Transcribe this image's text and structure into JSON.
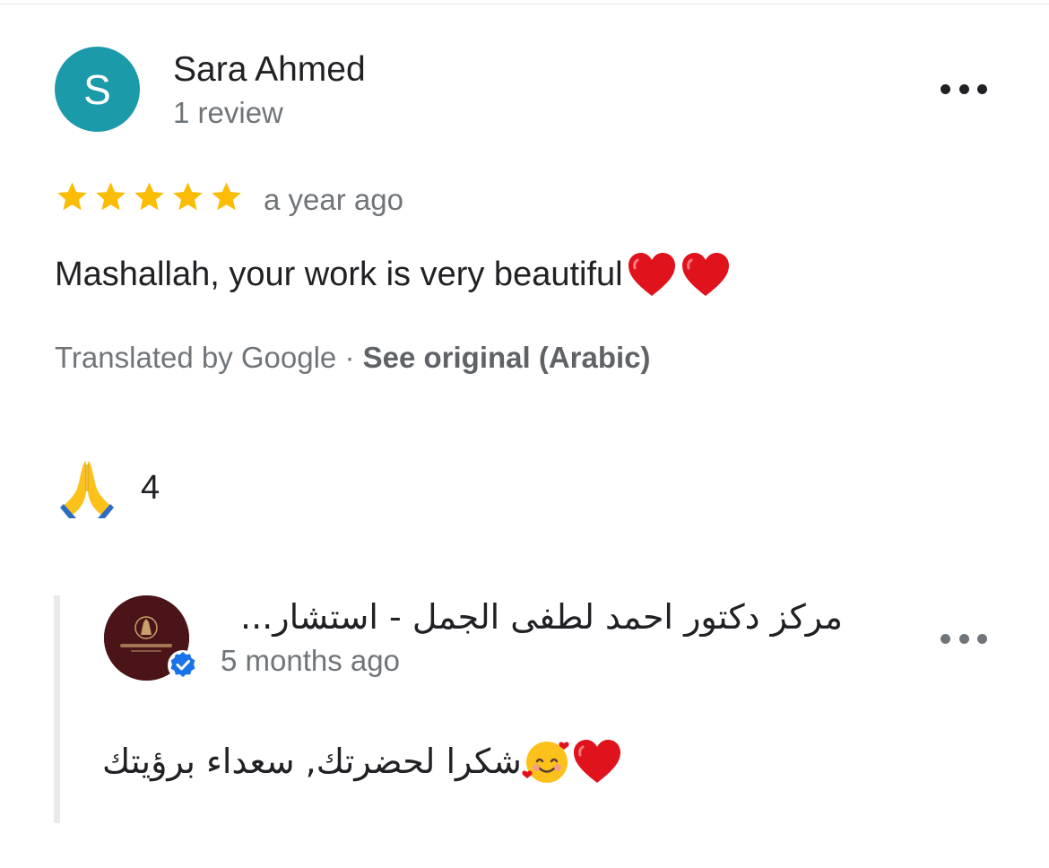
{
  "review": {
    "reviewer": {
      "initial": "S",
      "name": "Sara Ahmed",
      "meta": "1 review",
      "avatar_color": "#1b9aaa"
    },
    "rating": 5,
    "time": "a year ago",
    "text": "Mashallah, your work is very beautiful",
    "text_emojis": [
      "red-heart",
      "red-heart"
    ],
    "translated_by": "Translated by Google ·",
    "see_original": "See original (Arabic)",
    "reaction": {
      "icon": "folded-hands-icon",
      "count": "4"
    }
  },
  "owner_reply": {
    "name": "مركز دكتور احمد لطفى الجمل - استشار...",
    "time": "5 months ago",
    "text": "شكرا لحضرتك, سعداء برؤيتك",
    "emojis": [
      "red-heart",
      "smiling-face-with-hearts"
    ],
    "verified": true
  },
  "colors": {
    "star": "#fbbc04",
    "secondary_text": "#70757a",
    "verified_badge": "#1a73e8",
    "owner_avatar_bg": "#4a1418"
  }
}
